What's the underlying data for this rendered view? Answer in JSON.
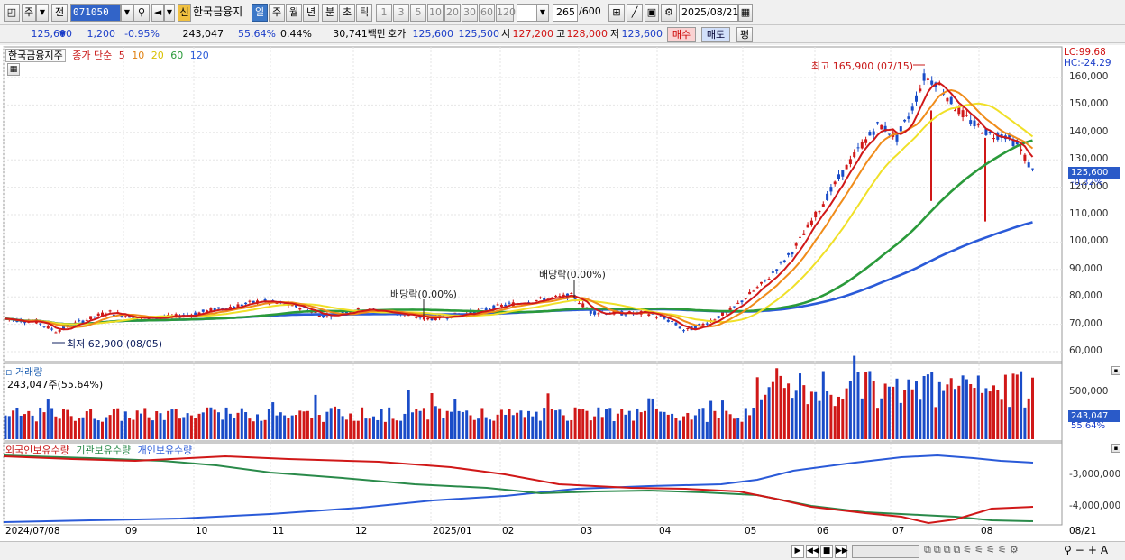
{
  "toolbar": {
    "period_main": "주",
    "period_prefix": "전",
    "code": "071050",
    "new_badge": "신",
    "stock_name": "한국금융지",
    "periods": [
      "일",
      "주",
      "월",
      "년",
      "분",
      "초",
      "틱"
    ],
    "intervals": [
      "1",
      "3",
      "5",
      "10",
      "20",
      "30",
      "60",
      "120"
    ],
    "count": "265",
    "count_max": "/600",
    "date": "2025/08/21"
  },
  "quote": {
    "price": "125,600",
    "change": "1,200",
    "change_pct": "-0.95%",
    "volume": "243,047",
    "vol_ratio": "55.64%",
    "turnover": "0.44%",
    "amount": "30,741백만",
    "bid_label": "호가",
    "ask": "125,600",
    "bid": "125,500",
    "open_label": "시",
    "open": "127,200",
    "high_label": "고",
    "high": "128,000",
    "low_label": "저",
    "low": "123,600",
    "buy_label": "매수",
    "sell_label": "매도",
    "eval_label": "평"
  },
  "price_panel": {
    "legend_name": "한국금융지주",
    "legend_type": "종가 단순",
    "ma_labels": [
      "5",
      "10",
      "20",
      "60",
      "120"
    ],
    "ma_colors": [
      "#d01818",
      "#f08c1a",
      "#f0e028",
      "#2a9a3a",
      "#2a5ad8"
    ],
    "lc": "LC:99.68",
    "hc": "HC:-24.29",
    "y_ticks": [
      "160,000",
      "150,000",
      "140,000",
      "130,000",
      "120,000",
      "110,000",
      "100,000",
      "90,000",
      "80,000",
      "70,000",
      "60,000"
    ],
    "last_price_tag": "125,600",
    "last_change_tag": "-0.32%",
    "high_annot": "최고 165,900 (07/15)",
    "low_annot": "최저 62,900 (08/05)",
    "div_annot_1": "배당락(0.00%)",
    "div_annot_2": "배당락(0.00%)"
  },
  "volume_panel": {
    "title": "거래량",
    "info": "243,047주(55.64%)",
    "y_tick": "500,000",
    "tag_value": "243,047",
    "tag_pct": "55.64%"
  },
  "holding_panel": {
    "labels": [
      "외국인보유수량",
      "기관보유수량",
      "개인보유수량"
    ],
    "colors": [
      "#d01818",
      "#2a9a5a",
      "#2a5ad8"
    ],
    "y_ticks": [
      "-3,000,000",
      "-4,000,000"
    ]
  },
  "x_axis": [
    "2024/07/08",
    "09",
    "10",
    "11",
    "12",
    "2025/01",
    "02",
    "03",
    "04",
    "05",
    "06",
    "07",
    "08"
  ],
  "x_end": "08/21",
  "chart_data": {
    "type": "line",
    "title": "한국금융지주",
    "x": [
      "2024-07",
      "2024-08",
      "2024-09",
      "2024-10",
      "2024-11",
      "2024-12",
      "2025-01",
      "2025-02",
      "2025-03",
      "2025-04",
      "2025-05",
      "2025-06",
      "2025-07",
      "2025-08"
    ],
    "series": [
      {
        "name": "종가",
        "values": [
          72000,
          68000,
          73000,
          74000,
          77000,
          74000,
          73000,
          79000,
          74000,
          70000,
          80000,
          115000,
          150000,
          125600
        ]
      }
    ],
    "ylim": [
      55000,
      170000
    ]
  }
}
